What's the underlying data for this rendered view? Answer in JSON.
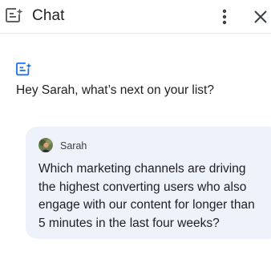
{
  "header": {
    "title": "Chat",
    "app_icon": "chat-spark-icon",
    "more_icon": "more-vert-icon",
    "close_icon": "close-icon"
  },
  "conversation": {
    "assistant_icon": "chat-spark-icon",
    "greeting": "Hey Sarah, what’s next on your list?",
    "user_message": {
      "sender": "Sarah",
      "avatar": "user-avatar",
      "text": "Which marketing channels are driving the highest converting users who also engage with our content for longer than 5 minutes in the last four weeks?"
    }
  },
  "colors": {
    "bubble_background": "#eef2fb",
    "assistant_icon": "#1a73e8",
    "text": "#202124"
  }
}
